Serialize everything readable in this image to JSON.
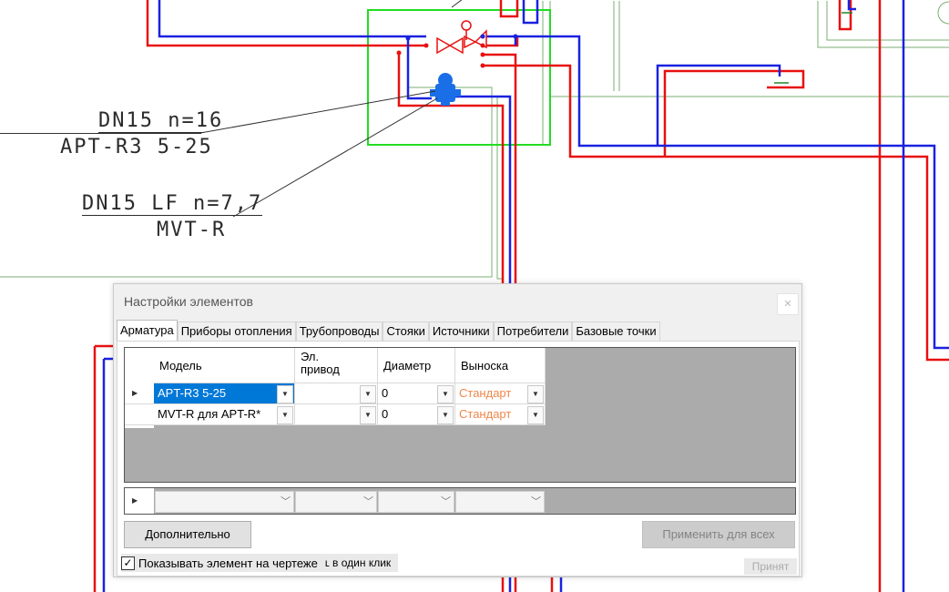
{
  "cad": {
    "labels": [
      {
        "text": "DN15 n=16"
      },
      {
        "text": "APT-R3 5-25"
      },
      {
        "text": "DN15 LF n=7,7"
      },
      {
        "text": "MVT-R"
      }
    ],
    "colors": {
      "supply": "#e81010",
      "return": "#1a22e0",
      "frame": "#22dd22",
      "walls": "#7aaf72",
      "leader": "#333333"
    }
  },
  "dialog": {
    "title": "Настройки элементов",
    "close_icon": "close-icon",
    "tabs": [
      "Арматура",
      "Приборы отопления",
      "Трубопроводы",
      "Стояки",
      "Источники",
      "Потребители",
      "Базовые точки"
    ],
    "active_tab": "Арматура",
    "grid": {
      "columns": [
        "Модель",
        "Эл. привод",
        "Диаметр",
        "Выноска"
      ],
      "rows": [
        {
          "model": "APT-R3 5-25",
          "drive": "",
          "diameter": "0",
          "leader": "Стандарт"
        },
        {
          "model": "MVT-R для APT-R*",
          "drive": "",
          "diameter": "0",
          "leader": "Стандарт"
        }
      ]
    },
    "buttons": {
      "more": "Дополнительно",
      "apply_all": "Применить для всех",
      "accept": "Принят"
    },
    "checkbox": {
      "label": "Показывать элемент на чертеже",
      "checked": true,
      "suffix": "в один клик"
    }
  }
}
